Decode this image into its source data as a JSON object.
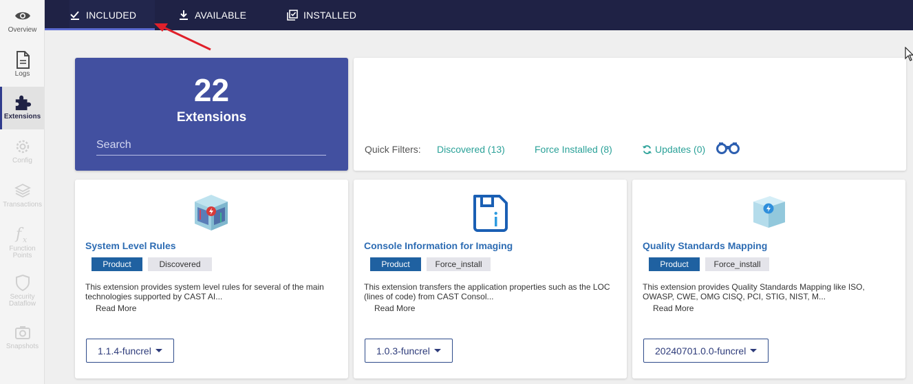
{
  "sidebar": {
    "items": [
      {
        "label": "Overview",
        "icon": "eye-icon"
      },
      {
        "label": "Logs",
        "icon": "document-icon"
      },
      {
        "label": "Extensions",
        "icon": "puzzle-icon"
      },
      {
        "label": "Config",
        "icon": "gear-icon"
      },
      {
        "label": "Transactions",
        "icon": "layers-icon"
      },
      {
        "label": "Function Points",
        "icon": "function-icon"
      },
      {
        "label": "Security Dataflow",
        "icon": "shield-icon"
      },
      {
        "label": "Snapshots",
        "icon": "camera-icon"
      }
    ]
  },
  "tabs": [
    {
      "label": "INCLUDED",
      "icon": "check-icon"
    },
    {
      "label": "AVAILABLE",
      "icon": "download-icon"
    },
    {
      "label": "INSTALLED",
      "icon": "installed-icon"
    }
  ],
  "summary": {
    "count": "22",
    "title": "Extensions",
    "search_placeholder": "Search"
  },
  "filters": {
    "label": "Quick Filters:",
    "discovered": "Discovered (13)",
    "force_installed": "Force Installed (8)",
    "updates": "Updates (0)"
  },
  "cards": [
    {
      "name": "System Level Rules",
      "type": "Product",
      "tag": "Discovered",
      "description": "This extension provides system level rules for several of the main technologies supported by CAST AI...",
      "read_more": "Read More",
      "version": "1.1.4-funcrel"
    },
    {
      "name": "Console Information for Imaging",
      "type": "Product",
      "tag": "Force_install",
      "description": "This extension transfers the application properties such as the LOC (lines of code) from CAST Consol...",
      "read_more": "Read More",
      "version": "1.0.3-funcrel"
    },
    {
      "name": "Quality Standards Mapping",
      "type": "Product",
      "tag": "Force_install",
      "description": "This extension provides Quality Standards Mapping like ISO, OWASP, CWE, OMG CISQ, PCI, STIG, NIST, M...",
      "read_more": "Read More",
      "version": "20240701.0.0-funcrel"
    }
  ],
  "colors": {
    "topbar": "#1f2245",
    "summary_bg": "#4250a0",
    "link": "#2aa198",
    "card_title": "#2d6cb3",
    "badge_product": "#1f61a1"
  }
}
